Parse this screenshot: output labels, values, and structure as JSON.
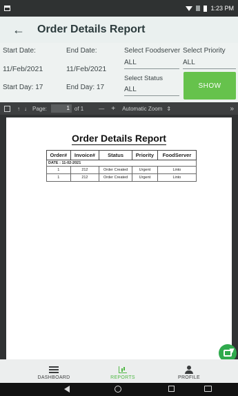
{
  "status_bar": {
    "time": "1:23 PM"
  },
  "app_bar": {
    "title": "Order Details Report"
  },
  "filters": {
    "start_date_label": "Start Date:",
    "start_date_value": "11/Feb/2021",
    "start_day": "Start Day: 17",
    "end_date_label": "End Date:",
    "end_date_value": "11/Feb/2021",
    "end_day": "End Day: 17",
    "foodserver_label": "Select Foodserver",
    "foodserver_value": "ALL",
    "status_label": "Select Status",
    "status_value": "ALL",
    "priority_label": "Select Priority",
    "priority_value": "ALL",
    "show_button": "SHOW"
  },
  "pdf_toolbar": {
    "page_label": "Page:",
    "page_value": "1",
    "page_of": "of 1",
    "minus": "—",
    "plus": "+",
    "zoom": "Automatic Zoom",
    "zoom_arrow": "⇕",
    "more": "»"
  },
  "report": {
    "title": "Order Details Report",
    "columns": [
      "Order#",
      "Invoice#",
      "Status",
      "Priority",
      "FoodServer"
    ],
    "date_group": "DATE : 11-02-2021",
    "rows": [
      {
        "order": "1",
        "invoice": "212",
        "status": "Order Created",
        "priority": "Urgent",
        "foodserver": "Linto"
      },
      {
        "order": "1",
        "invoice": "212",
        "status": "Order Created",
        "priority": "Urgent",
        "foodserver": "Linto"
      }
    ]
  },
  "bottom_nav": {
    "items": [
      {
        "label": "DASHBOARD",
        "icon": "dashboard-icon"
      },
      {
        "label": "REPORTS",
        "icon": "reports-icon",
        "active": true
      },
      {
        "label": "PROFILE",
        "icon": "profile-icon"
      }
    ]
  },
  "colors": {
    "accent": "#66c24c",
    "active_nav": "#4fb844",
    "viewer_bg": "#303233",
    "status_bar": "#2f3232"
  }
}
